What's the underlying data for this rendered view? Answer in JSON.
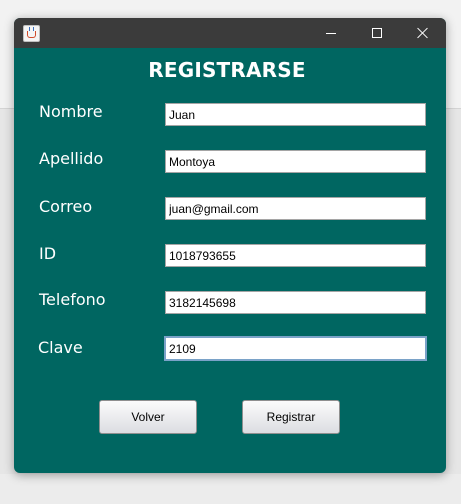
{
  "window": {
    "icon": "java-cup-icon",
    "controls": [
      "minimize-icon",
      "maximize-icon",
      "close-icon"
    ]
  },
  "form": {
    "title": "REGISTRARSE",
    "fields": [
      {
        "label": "Nombre",
        "value": "Juan"
      },
      {
        "label": "Apellido",
        "value": "Montoya"
      },
      {
        "label": "Correo",
        "value": "juan@gmail.com"
      },
      {
        "label": "ID",
        "value": "1018793655"
      },
      {
        "label": "Telefono",
        "value": "3182145698"
      },
      {
        "label": "Clave",
        "value": "2109",
        "focused": true
      }
    ],
    "buttons": {
      "back_label": "Volver",
      "submit_label": "Registrar"
    }
  },
  "colors": {
    "form_background": "#006661",
    "titlebar": "#3b3b3b",
    "text": "#ffffff",
    "focus_border": "#7aa2c8"
  }
}
